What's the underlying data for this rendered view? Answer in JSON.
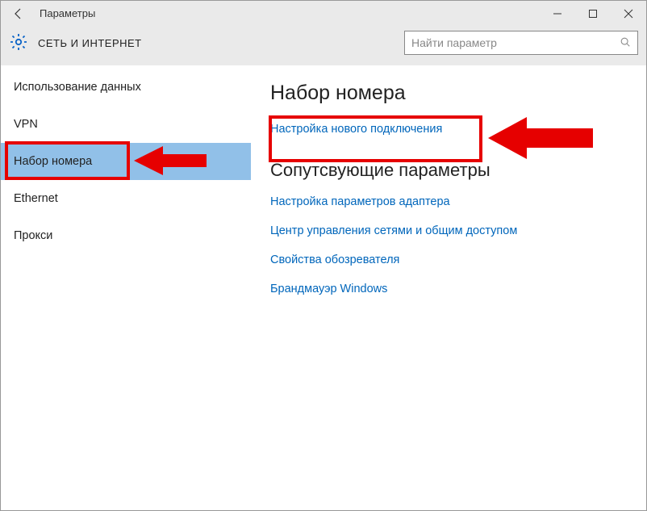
{
  "window": {
    "title": "Параметры"
  },
  "header": {
    "title": "СЕТЬ И ИНТЕРНЕТ"
  },
  "search": {
    "placeholder": "Найти параметр"
  },
  "sidebar": {
    "items": [
      {
        "label": "Использование данных"
      },
      {
        "label": "VPN"
      },
      {
        "label": "Набор номера"
      },
      {
        "label": "Ethernet"
      },
      {
        "label": "Прокси"
      }
    ],
    "selected_index": 2
  },
  "main": {
    "heading": "Набор номера",
    "primary_link": "Настройка нового подключения",
    "related_heading": "Сопутсвующие параметры",
    "related_links": [
      "Настройка параметров адаптера",
      "Центр управления сетями и общим доступом",
      "Свойства обозревателя",
      "Брандмауэр Windows"
    ]
  },
  "colors": {
    "selection": "#91c0e8",
    "link": "#0066bb",
    "highlight": "#e60000",
    "chrome_bg": "#eaeaea",
    "gear": "#0a63c7"
  }
}
